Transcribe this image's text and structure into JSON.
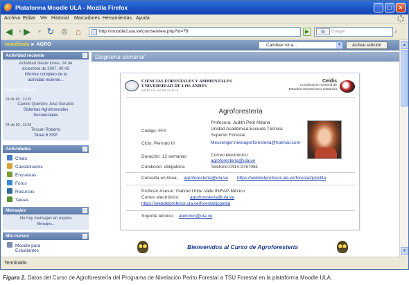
{
  "window": {
    "title": "Plataforma Moodle ULA - Mozilla Firefox",
    "controls": {
      "minimize": "_",
      "maximize": "□",
      "close": "×"
    }
  },
  "menu": [
    "Archivo",
    "Editar",
    "Ver",
    "Historial",
    "Marcadores",
    "Herramientas",
    "Ayuda"
  ],
  "nav": {
    "url": "http://moodle2.ula.ve/course/view.php?id=78",
    "search_placeholder": "Google",
    "search_engine_label": "G"
  },
  "moodle": {
    "site_name": "moodleula",
    "breadcrumb_sep": "►",
    "course_short": "AGRO",
    "role_select": "Cambiar rol a...",
    "edit_button": "Activar edición"
  },
  "sidebar": {
    "recent": {
      "title": "Actividad reciente",
      "line1": "Actividad desde lunes, 24 de",
      "line2": "diciembre de 2007, 00:43",
      "line3": "Informe completo de la",
      "line4": "actividad reciente...",
      "section": "Tareas entregadas:",
      "entries": [
        {
          "date": "24 dic 00:, 12:39",
          "line1": "Camilo Quintero José Gerardo",
          "line2": "Sistemas Agroforestales",
          "line3": "Secuenciales"
        },
        {
          "date": "24 dic 00:, 13:39",
          "line1": "Tescari Roberto",
          "line2": "Tarea 6 SSP"
        }
      ]
    },
    "activities": {
      "title": "Actividades",
      "items": [
        {
          "label": "Chats",
          "icon": "chat-icon",
          "color": "#4a7ac8"
        },
        {
          "label": "Cuestionarios",
          "icon": "quiz-icon",
          "color": "#d9a23a"
        },
        {
          "label": "Encuestas",
          "icon": "survey-icon",
          "color": "#7b9c3a"
        },
        {
          "label": "Foros",
          "icon": "forum-icon",
          "color": "#3a8ad1"
        },
        {
          "label": "Recursos",
          "icon": "resource-icon",
          "color": "#2f6b9e"
        },
        {
          "label": "Tareas",
          "icon": "assignment-icon",
          "color": "#5a8f3a"
        }
      ]
    },
    "messages": {
      "title": "Mensajes",
      "line1": "No hay mensajes en espera",
      "line2": "Mensajes..."
    },
    "courses": {
      "title": "Mis cursos",
      "line1": "Moodle para",
      "line2": "Estudiantes"
    }
  },
  "main": {
    "section_title": "Diagrama semanal",
    "header": {
      "ula_line1": "CIENCIAS FORESTALES Y AMBIENTALES",
      "ula_line2": "UNIVERSIDAD DE LOS ANDES",
      "ula_line3": "MÉRIDA  VENEZUELA",
      "ceidis_name": "Ceidis",
      "ceidis_sub1": "Coordinación General de",
      "ceidis_sub2": "Estudios Interactivos a Distancia"
    },
    "course": {
      "title": "Agroforestería",
      "rows": [
        {
          "label": "Código: FFA",
          "value": "Profesora: Judith Petit Aldana"
        },
        {
          "label": "",
          "value": "Unidad Académica:Escuela Técnica"
        },
        {
          "label": "",
          "value": "Superior Forestal"
        },
        {
          "label": "Ciclo: Período III",
          "value": "Messenger:nivelagroforesteria@hotmail.com"
        },
        {
          "label": "Duración: 13 semanas",
          "value": "Correo electrónico:"
        },
        {
          "label": "",
          "value": "agroforesteria@ula.ve"
        },
        {
          "label": "Condición: obligatoria",
          "value": "Teléfono:0414-9787061"
        }
      ],
      "consult_label": "Consulta en línea:",
      "consult_email": "agroforesteria@ula.ve",
      "consult_url": "https://webdelprofesor.ula.ve/forestal/jcpetita",
      "advisor": "Profesor Asesor: Gabriel Uribe Valle INIFAP-México",
      "advisor_mail_label": "Correo electrónico:",
      "advisor_mail": "agroforesteria@ula.ve",
      "advisor_url": "https://webdelprofesor.ula.ve/forestal/jcpetita",
      "support_label": "Soporte técnico:",
      "support_mail": "atencion@ula.ve"
    },
    "welcome": "Bienvenidos al Curso de Agroforestería"
  },
  "status": "Terminado",
  "caption": {
    "fig": "Figura 2.",
    "text": " Datos del Curso de Agroforestería del Programa de Nivelación Perito Forestal a TSU Forestal en la plataforma Moodle ULA."
  }
}
